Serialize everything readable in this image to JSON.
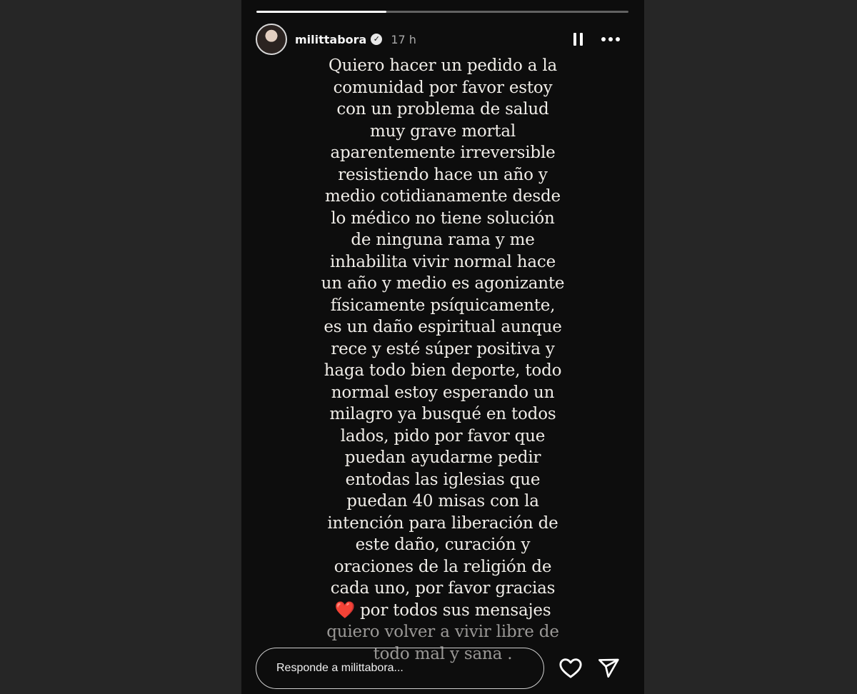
{
  "story": {
    "progress": 0.35,
    "author": {
      "username": "milittabora",
      "verified_icon": "verified-badge-icon",
      "time": "17 h"
    },
    "controls": {
      "pause_icon": "pause-icon",
      "more_icon": "more-options-icon"
    },
    "text_lines": [
      "Quiero hacer un pedido a la",
      "comunidad por favor estoy",
      "con un problema de salud",
      "muy grave mortal",
      "aparentemente irreversible",
      "resistiendo hace un año y",
      "medio cotidianamente desde",
      "lo médico no tiene solución",
      "de ninguna rama y me",
      "inhabilita vivir normal hace",
      "un año y medio es agonizante",
      "físicamente psíquicamente,",
      "es un daño espiritual aunque",
      "rece y esté súper positiva y",
      "haga todo bien deporte, todo",
      "normal estoy esperando un",
      "milagro ya busqué en todos",
      "lados, pido por favor que",
      "puedan ayudarme pedir",
      "entodas las iglesias que",
      "puedan 40 misas con la",
      "intención para liberación de",
      "este daño, curación y",
      "oraciones de la religión de",
      "cada uno, por favor gracias"
    ],
    "heart_emoji": "❤️",
    "heart_line_text": " por todos sus mensajes",
    "final_lines": [
      "quiero volver a vivir libre de",
      "todo mal y sana ."
    ],
    "footer": {
      "reply_placeholder": "Responde a milittabora...",
      "like_icon": "heart-outline-icon",
      "share_icon": "send-icon"
    }
  },
  "colors": {
    "page_background": "#262626",
    "story_background": "#0d0d0d",
    "text": "#f0ede8",
    "heart": "#d9232e"
  }
}
